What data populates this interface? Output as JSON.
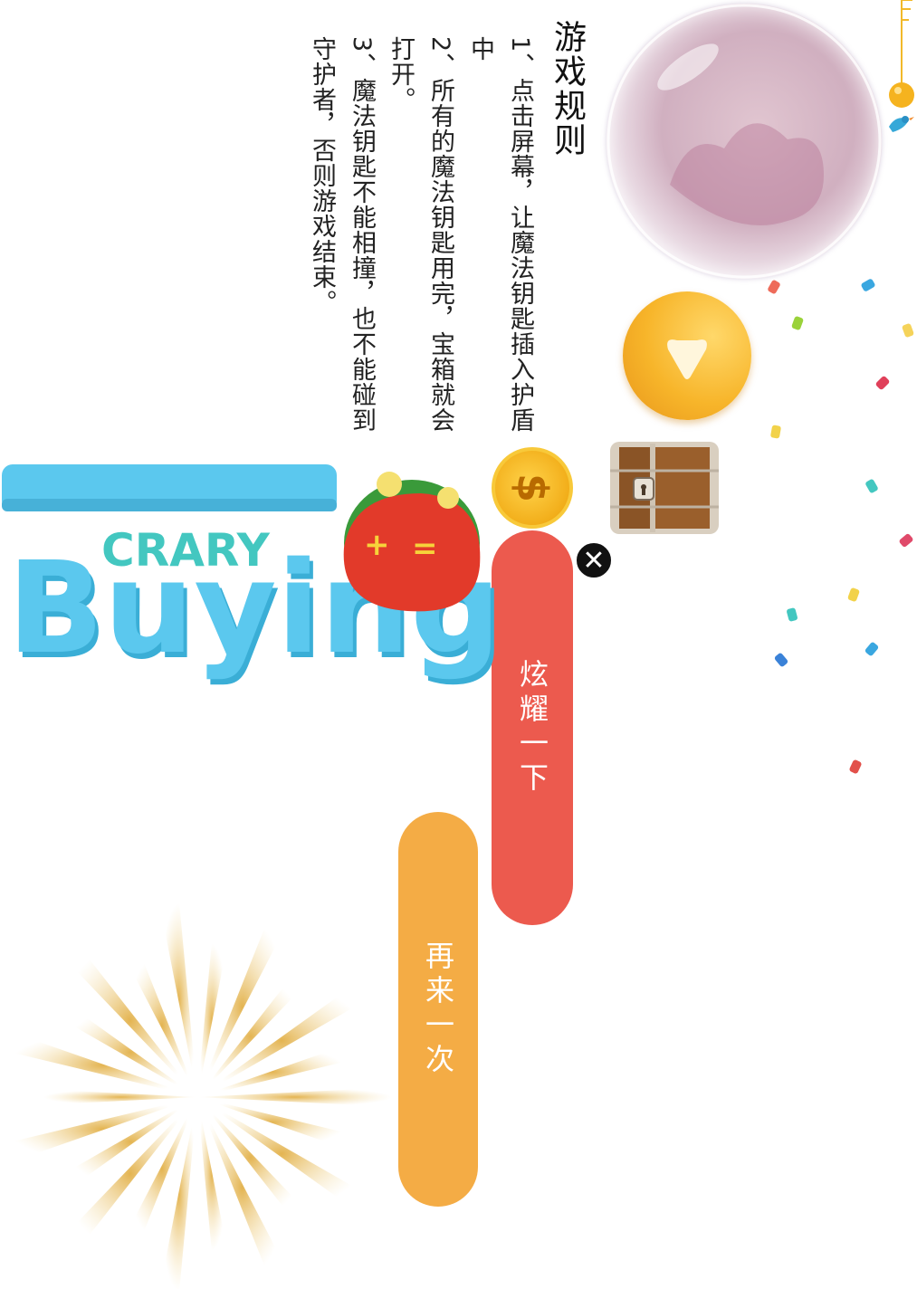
{
  "rules": {
    "title": "游戏规则",
    "line1": "1、点击屏幕，让魔法钥匙插入护盾中",
    "line2": "2、所有的魔法钥匙用完，宝箱就会打开。",
    "line3": "3、魔法钥匙不能相撞，也不能碰到守护者，否则游戏结束。"
  },
  "buttons": {
    "show_off": "炫耀一下",
    "play_again": "再来一次",
    "close_icon": "close-icon"
  },
  "coin": {
    "symbol": "$"
  },
  "logo": {
    "word_top": "CRARY",
    "word_main": "Buying",
    "wallet_plus": "+",
    "wallet_equal": "="
  },
  "colors": {
    "show_off": "#ec5a4e",
    "play_again": "#f4ac45",
    "logo_blue": "#5bc8ee",
    "logo_teal": "#43c7c0"
  },
  "icons": [
    "bubble-icon",
    "play-icon",
    "treasure-chest-icon",
    "coin-icon",
    "wallet-icon",
    "sunburst-icon",
    "key-icon",
    "bird-icon"
  ]
}
